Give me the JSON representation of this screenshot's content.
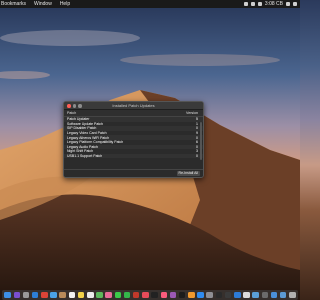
{
  "menubar": {
    "items": [
      "Bookmarks",
      "Window",
      "Help"
    ],
    "clock": "3:08 CB"
  },
  "window": {
    "title": "Installed Patch Updates",
    "columns": {
      "patch": "Patch",
      "version": "Version"
    },
    "rows": [
      {
        "name": "Patch Updater",
        "version": "5"
      },
      {
        "name": "Software Update Patch",
        "version": "1"
      },
      {
        "name": "SIP Disabler Patch",
        "version": "0"
      },
      {
        "name": "Legacy Video Card Patch",
        "version": "9"
      },
      {
        "name": "Legacy Atheros WiFi Patch",
        "version": "0"
      },
      {
        "name": "Legacy Platform Compatibility Patch",
        "version": "6"
      },
      {
        "name": "Legacy Audio Patch",
        "version": "0"
      },
      {
        "name": "Night Shift Patch",
        "version": "3"
      },
      {
        "name": "USB1.1 Support Patch",
        "version": "0"
      }
    ],
    "reinstall_label": "Re-Install All"
  },
  "dock": {
    "icons": [
      {
        "name": "finder-icon",
        "color": "#3d8fe6"
      },
      {
        "name": "siri-icon",
        "color": "#7a4fcf"
      },
      {
        "name": "launchpad-icon",
        "color": "#9a9a9a"
      },
      {
        "name": "safari-icon",
        "color": "#2d7fd6"
      },
      {
        "name": "chrome-icon",
        "color": "#db4437"
      },
      {
        "name": "mail-icon",
        "color": "#4aa3e8"
      },
      {
        "name": "contacts-icon",
        "color": "#b88b5a"
      },
      {
        "name": "calendar-icon",
        "color": "#f2f2f2"
      },
      {
        "name": "notes-icon",
        "color": "#f3d34a"
      },
      {
        "name": "reminders-icon",
        "color": "#ececec"
      },
      {
        "name": "maps-icon",
        "color": "#5cb85c"
      },
      {
        "name": "photos-icon",
        "color": "#e86a9a"
      },
      {
        "name": "messages-icon",
        "color": "#3cc94a"
      },
      {
        "name": "facetime-icon",
        "color": "#34b64a"
      },
      {
        "name": "photo-booth-icon",
        "color": "#c0392b"
      },
      {
        "name": "news-icon",
        "color": "#e84c5a"
      },
      {
        "name": "stocks-icon",
        "color": "#222222"
      },
      {
        "name": "music-icon",
        "color": "#fc5c7d"
      },
      {
        "name": "podcasts-icon",
        "color": "#9b59b6"
      },
      {
        "name": "tv-icon",
        "color": "#1c1c1c"
      },
      {
        "name": "books-icon",
        "color": "#f29a2e"
      },
      {
        "name": "app-store-icon",
        "color": "#2f8cf0"
      },
      {
        "name": "system-preferences-icon",
        "color": "#8e8e93"
      },
      {
        "name": "terminal-icon",
        "color": "#2a2a2a"
      },
      {
        "name": "activity-monitor-icon",
        "color": "#3a3a3a"
      },
      {
        "name": "xcode-icon",
        "color": "#2d7bd6"
      },
      {
        "name": "textedit-icon",
        "color": "#dcdcdc"
      },
      {
        "name": "preview-icon",
        "color": "#5aa0d8"
      },
      {
        "name": "patch-updater-icon",
        "color": "#6b6b6b"
      },
      {
        "name": "downloads-icon",
        "color": "#4a90d9"
      },
      {
        "name": "documents-icon",
        "color": "#5b9bd5"
      },
      {
        "name": "trash-icon",
        "color": "#b0b0b0"
      }
    ]
  }
}
